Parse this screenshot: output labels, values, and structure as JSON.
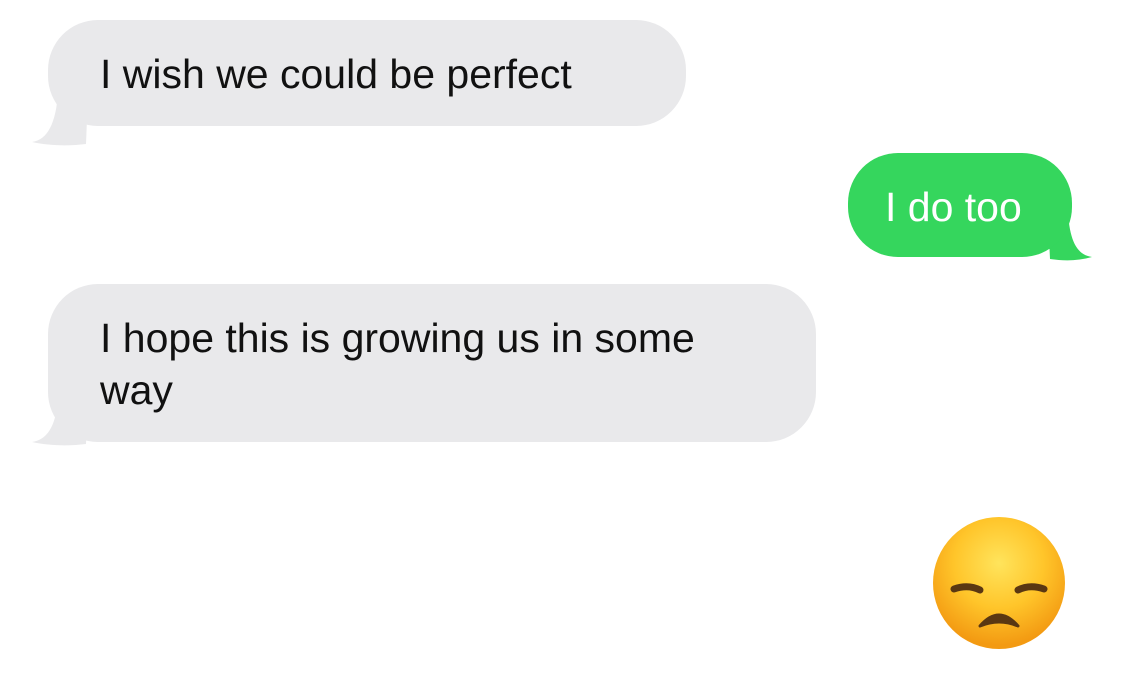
{
  "conversation": {
    "messages": [
      {
        "direction": "received",
        "text": "I wish we could be perfect"
      },
      {
        "direction": "sent",
        "text": "I do too"
      },
      {
        "direction": "received",
        "text": "I hope this is growing us in some way"
      },
      {
        "direction": "sent",
        "emoji": "disappointed-face"
      }
    ]
  },
  "colors": {
    "received_bubble": "#e9e9eb",
    "sent_bubble": "#35d65d",
    "received_text": "#111111",
    "sent_text": "#ffffff",
    "background": "#ffffff"
  }
}
